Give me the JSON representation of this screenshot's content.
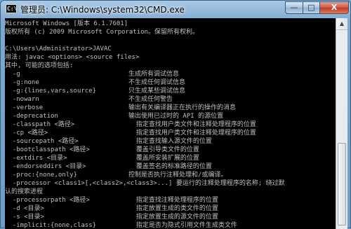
{
  "window": {
    "title": "管理员: C:\\Windows\\system32\\CMD.exe",
    "icon_text": "C:\\",
    "controls": {
      "minimize": "—",
      "maximize": "□",
      "close": "X"
    }
  },
  "console": {
    "header": [
      "Microsoft Windows [版本 6.1.7601]",
      "版权所有 (c) 2009 Microsoft Corporation。保留所有权利。",
      "",
      "C:\\Users\\Administrator>JAVAC",
      "用法: javac <options> <source files>",
      "其中, 可能的选项包括:"
    ],
    "options": [
      {
        "switch": "  -g",
        "desc": "生成所有调试信息"
      },
      {
        "switch": "  -g:none",
        "desc": "不生成任何调试信息"
      },
      {
        "switch": "  -g:{lines,vars,source}",
        "desc": "只生成某些调试信息"
      },
      {
        "switch": "  -nowarn",
        "desc": "不生成任何警告"
      },
      {
        "switch": "  -verbose",
        "desc": "输出有关编译器正在执行的操作的消息"
      },
      {
        "switch": "  -deprecation",
        "desc": "输出使用已过时的 API 的源位置"
      },
      {
        "switch": "  -classpath <路径>",
        "desc": "  指定查找用户类文件和注释处理程序的位置"
      },
      {
        "switch": "  -cp <路径>",
        "desc": "  指定查找用户类文件和注释处理程序的位置"
      },
      {
        "switch": "  -sourcepath <路径>",
        "desc": "  指定查找输入源文件的位置"
      },
      {
        "switch": "  -bootclasspath <路径>",
        "desc": "  覆盖引导类文件的位置"
      },
      {
        "switch": "  -extdirs <目录>",
        "desc": "  覆盖所安装扩展的位置"
      },
      {
        "switch": "  -endorseddirs <目录>",
        "desc": "  覆盖签名的标准路径的位置"
      },
      {
        "switch": "  -proc:{none,only}",
        "desc": "控制是否执行注释处理和/或编译。"
      }
    ],
    "wrap_line_1": "  -processor <class1>[,<class2>,<class3>...] 要运行的注释处理程序的名称; 绕过默",
    "wrap_line_2": "认的搜索进程",
    "options_after": [
      {
        "switch": "  -processorpath <路径>",
        "desc": "  指定查找注释处理程序的位置"
      },
      {
        "switch": "  -d <目录>",
        "desc": "  指定放置生成的类文件的位置"
      },
      {
        "switch": "  -s <目录>",
        "desc": "  指定放置生成的源文件的位置"
      },
      {
        "switch": "  -implicit:{none,class}",
        "desc": "  指定是否为隐式引用文件生成类文件"
      }
    ]
  },
  "scrollbar": {
    "up_arrow": "▲"
  }
}
